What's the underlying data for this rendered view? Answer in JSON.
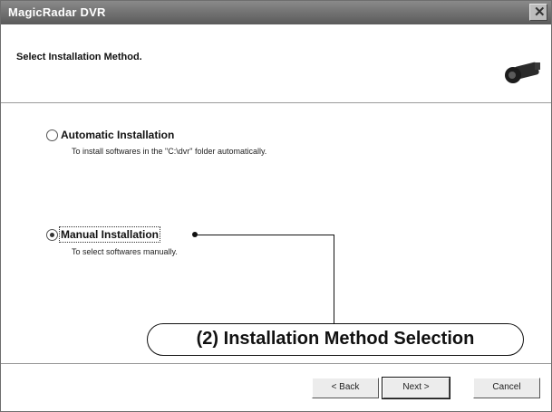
{
  "window": {
    "title": "MagicRadar DVR",
    "close_glyph": "✕"
  },
  "header": {
    "title": "Select Installation Method."
  },
  "options": [
    {
      "label": "Automatic Installation",
      "description": "To install softwares in the \"C:\\dvr\" folder automatically.",
      "selected": false
    },
    {
      "label": "Manual Installation",
      "description": "To select softwares manually.",
      "selected": true
    }
  ],
  "annotation": {
    "text": "(2) Installation Method Selection"
  },
  "buttons": {
    "back_label": "< Back",
    "next_label": "Next >",
    "cancel_label": "Cancel"
  },
  "icons": {
    "header_icon": "security-camera-icon",
    "close_icon": "close-icon"
  }
}
